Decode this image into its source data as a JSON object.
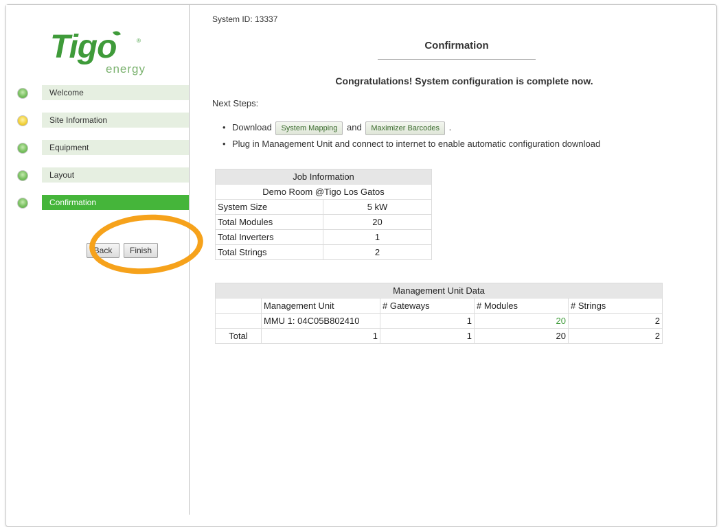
{
  "logo": {
    "brand": "Tigo",
    "sub": "energy",
    "reg": "®"
  },
  "steps": [
    {
      "label": "Welcome",
      "status": "green"
    },
    {
      "label": "Site Information",
      "status": "yellow"
    },
    {
      "label": "Equipment",
      "status": "green"
    },
    {
      "label": "Layout",
      "status": "green"
    },
    {
      "label": "Confirmation",
      "status": "green",
      "active": true
    }
  ],
  "nav": {
    "back_label": "Back",
    "finish_label": "Finish"
  },
  "main": {
    "system_id": "System ID: 13337",
    "title": "Confirmation",
    "congrats": "Congratulations! System configuration is complete now.",
    "next_steps": "Next Steps:",
    "bullet1": {
      "prefix": "Download",
      "btn1": "System Mapping",
      "joiner": "and",
      "btn2": "Maximizer Barcodes",
      "suffix": "."
    },
    "bullet2": "Plug in Management Unit and connect to internet to enable automatic configuration download"
  },
  "job": {
    "header": "Job Information",
    "site": "Demo Room @Tigo Los Gatos",
    "rows": [
      {
        "label": "System Size",
        "value": "5 kW"
      },
      {
        "label": "Total Modules",
        "value": "20"
      },
      {
        "label": "Total Inverters",
        "value": "1"
      },
      {
        "label": "Total Strings",
        "value": "2"
      }
    ]
  },
  "mgmt": {
    "header": "Management Unit Data",
    "columns": [
      "",
      "Management Unit",
      "# Gateways",
      "# Modules",
      "# Strings"
    ],
    "row": {
      "label": "",
      "unit": "MMU 1: 04C05B802410",
      "gateways": "1",
      "modules": "20",
      "strings": "2"
    },
    "total": {
      "label": "Total",
      "unit": "1",
      "gateways": "1",
      "modules": "20",
      "strings": "2"
    }
  },
  "colors": {
    "accent_green": "#45b53a",
    "annotation_orange": "#f6a21b"
  }
}
